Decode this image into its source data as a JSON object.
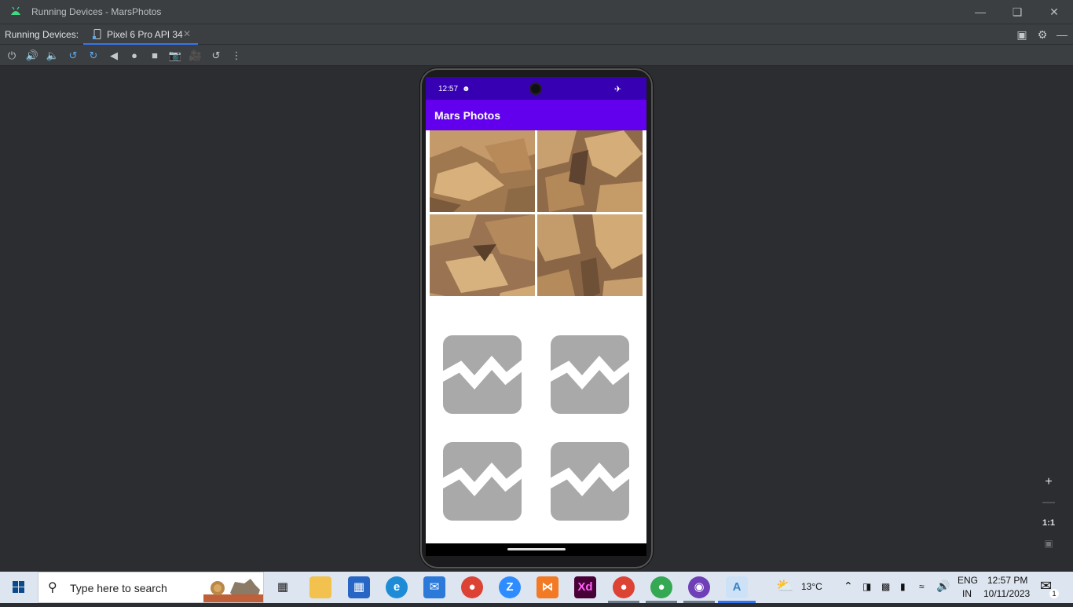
{
  "window": {
    "title": "Running Devices - MarsPhotos"
  },
  "tabs_bar": {
    "label": "Running Devices:",
    "active_tab": "Pixel 6 Pro API 34"
  },
  "colors": {
    "statusbar": "#3700b3",
    "appbar": "#6200ee",
    "placeholder": "#a9a9a9",
    "accent": "#3574f0"
  },
  "device": {
    "status_time": "12:57",
    "app_title": "Mars Photos",
    "photos": [
      "mars-rock-photo-1",
      "mars-rock-photo-2",
      "mars-rock-photo-3",
      "mars-rock-photo-4"
    ],
    "placeholders": [
      "broken-image-icon",
      "broken-image-icon",
      "broken-image-icon",
      "broken-image-icon"
    ]
  },
  "zoom_controls": {
    "fit_label": "1:1"
  },
  "taskbar": {
    "search_placeholder": "Type here to search",
    "weather": "13°C",
    "lang_top": "ENG",
    "lang_bottom": "IN",
    "time": "12:57 PM",
    "date": "10/11/2023",
    "notification_count": "1"
  }
}
